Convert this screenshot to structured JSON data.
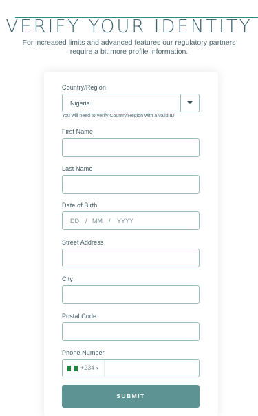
{
  "header": {
    "title": "VERIFY YOUR IDENTITY",
    "subtitle": "For increased limits and advanced features our regulatory partners require a bit more profile information."
  },
  "form": {
    "country": {
      "label": "Country/Region",
      "value": "Nigeria",
      "hint": "You will need to verify Country/Region with a valid ID."
    },
    "first_name": {
      "label": "First Name",
      "value": ""
    },
    "last_name": {
      "label": "Last Name",
      "value": ""
    },
    "dob": {
      "label": "Date of Birth",
      "day_placeholder": "DD",
      "month_placeholder": "MM",
      "year_placeholder": "YYYY",
      "separator": "/"
    },
    "street": {
      "label": "Street Address",
      "value": ""
    },
    "city": {
      "label": "City",
      "value": ""
    },
    "postal": {
      "label": "Postal Code",
      "value": ""
    },
    "phone": {
      "label": "Phone Number",
      "flag": "nigeria-flag-icon",
      "dial_code": "+234",
      "dropdown_icon": "caret-down-icon",
      "value": ""
    },
    "submit_label": "SUBMIT"
  },
  "colors": {
    "accent": "#5d9493",
    "title": "#3f6672",
    "border": "#9bbdc0",
    "flag_green": "#1f8a3e"
  }
}
